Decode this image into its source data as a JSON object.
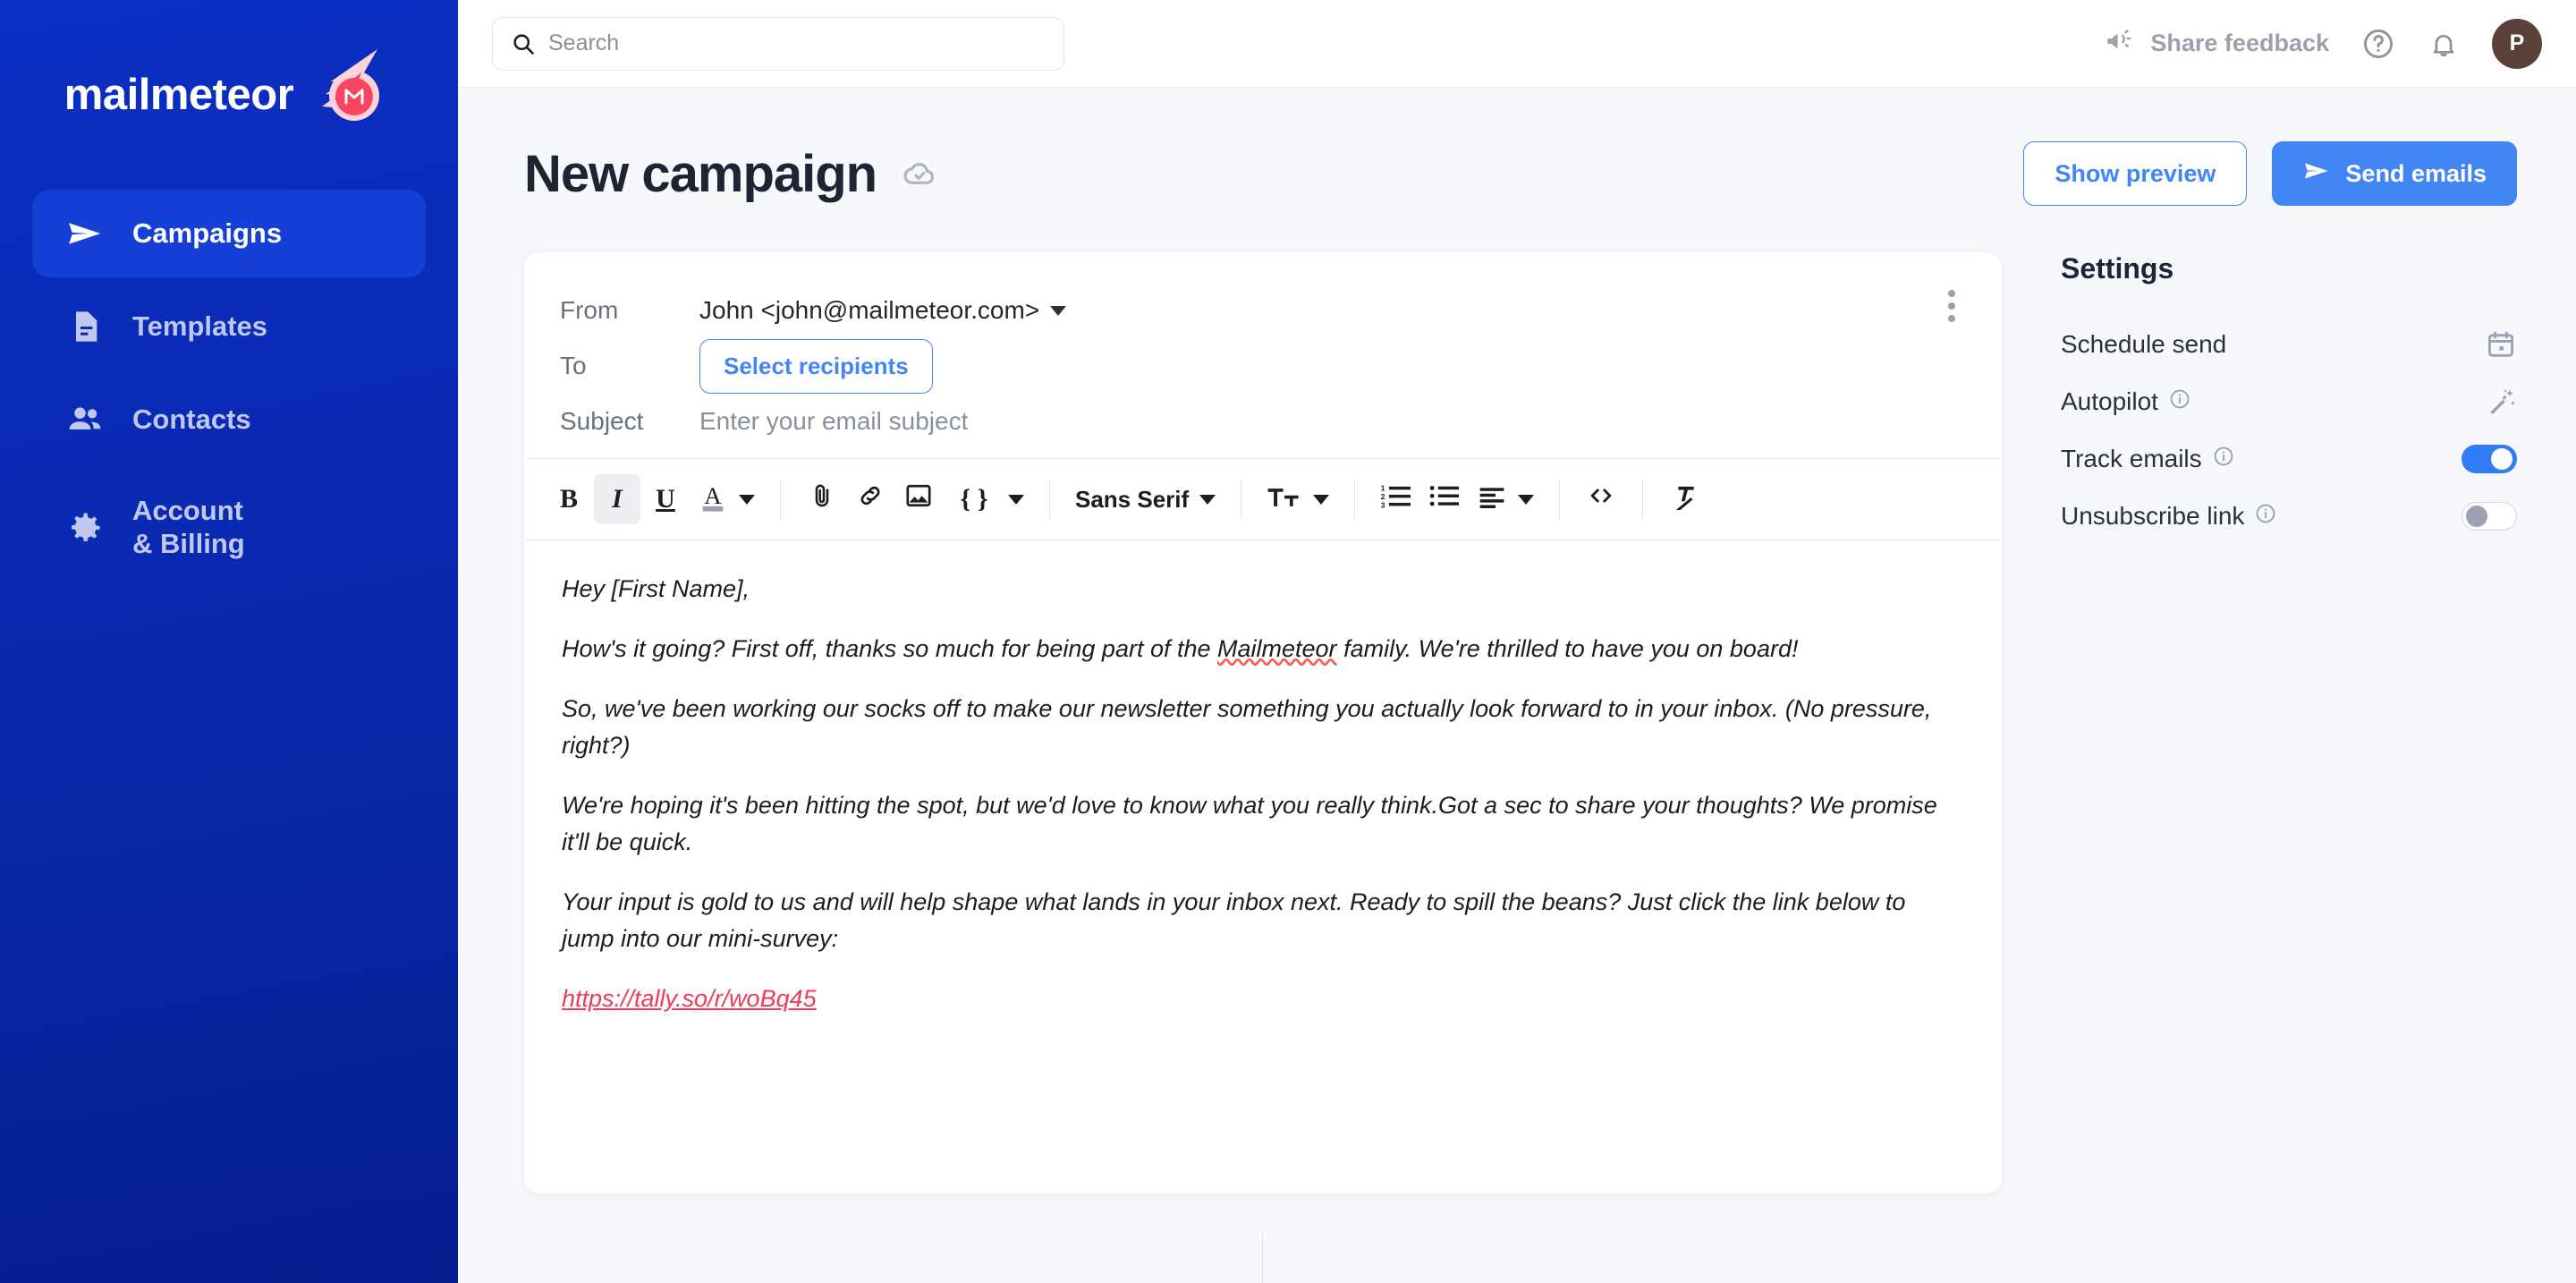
{
  "brand": {
    "name": "mailmeteor",
    "logo_letter": "M",
    "accent_blue": "#4285f4",
    "sidebar_blue": "#0b2fc4",
    "logo_red": "#f9455f"
  },
  "sidebar": {
    "items": [
      {
        "label": "Campaigns",
        "icon": "send-icon",
        "active": true
      },
      {
        "label": "Templates",
        "icon": "document-icon",
        "active": false
      },
      {
        "label": "Contacts",
        "icon": "people-icon",
        "active": false
      },
      {
        "label": "Account\n& Billing",
        "label_line1": "Account",
        "label_line2": "& Billing",
        "icon": "gear-icon",
        "active": false
      }
    ]
  },
  "topbar": {
    "search_placeholder": "Search",
    "search_value": "",
    "feedback_label": "Share feedback",
    "help_icon": "help-circle-icon",
    "bell_icon": "notification-bell-icon",
    "avatar_initial": "P"
  },
  "page": {
    "title": "New campaign",
    "saved_icon": "cloud-check-icon",
    "show_preview_label": "Show preview",
    "send_emails_label": "Send emails"
  },
  "composer": {
    "from_label": "From",
    "from_value": "John <john@mailmeteor.com>",
    "to_label": "To",
    "select_recipients_label": "Select recipients",
    "subject_label": "Subject",
    "subject_value": "",
    "subject_placeholder": "Enter your email subject",
    "more_options_icon": "kebab-menu-icon",
    "toolbar": {
      "bold": "B",
      "italic": "I",
      "underline": "U",
      "text_color": "A",
      "attach_icon": "paperclip-icon",
      "link_icon": "link-icon",
      "image_icon": "image-icon",
      "merge_field": "{ }",
      "font_family": "Sans Serif",
      "font_size_icon": "font-size-icon",
      "numbered_list_icon": "numbered-list-icon",
      "bullet_list_icon": "bullet-list-icon",
      "align_icon": "align-left-icon",
      "code_icon": "code-icon",
      "clear_format_icon": "clear-formatting-icon",
      "italic_active": true
    },
    "body": {
      "paragraphs": [
        "Hey [First Name],",
        "How's it going? First off, thanks so much for being part of the Mailmeteor family. We're thrilled to have you on board!",
        "So, we've been working our socks off to make our newsletter something you actually look forward to in your inbox. (No pressure, right?)",
        "We're hoping it's been hitting the spot, but we'd love to know what you really think.Got a sec to share your thoughts? We promise it'll be quick.",
        "Your input is gold to us and will help shape what lands in your inbox next. Ready to spill the beans? Just click the link below to jump into our mini-survey:"
      ],
      "misspelled_word": "Mailmeteor",
      "link_text": "https://tally.so/r/woBq45",
      "link_color": "#f2395a"
    }
  },
  "settings": {
    "title": "Settings",
    "rows": [
      {
        "label": "Schedule send",
        "info": false,
        "control": "calendar-icon",
        "state": ""
      },
      {
        "label": "Autopilot",
        "info": true,
        "info_icon": "info-icon",
        "control": "magic-wand-icon",
        "state": ""
      },
      {
        "label": "Track emails",
        "info": true,
        "info_icon": "info-icon",
        "control": "toggle",
        "state": "on"
      },
      {
        "label": "Unsubscribe link",
        "info": true,
        "info_icon": "info-icon",
        "control": "toggle",
        "state": "off"
      }
    ]
  }
}
